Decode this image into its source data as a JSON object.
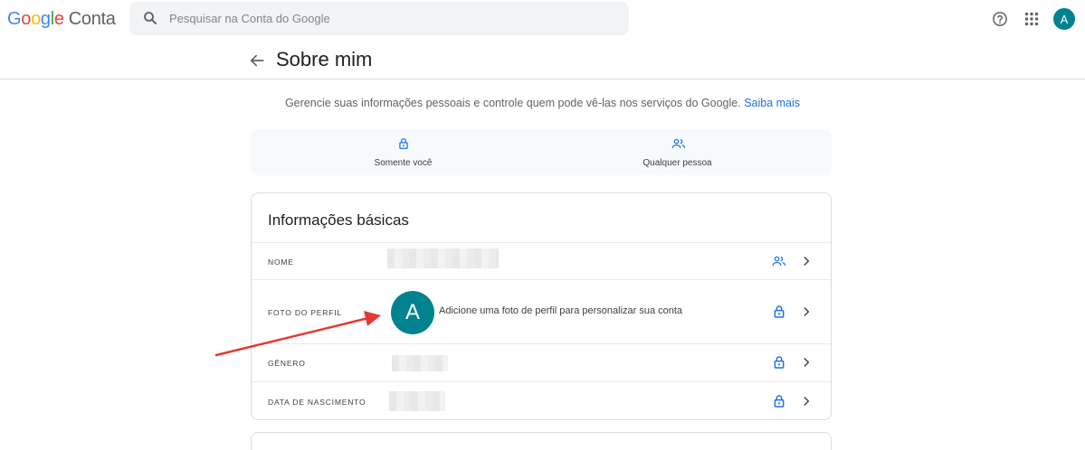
{
  "header": {
    "logo_letters": [
      "G",
      "o",
      "o",
      "g",
      "l",
      "e"
    ],
    "logo_suffix": "Conta",
    "search_placeholder": "Pesquisar na Conta do Google",
    "help_icon": "help-circle-icon",
    "apps_icon": "apps-grid-icon",
    "avatar_letter": "A"
  },
  "page": {
    "title": "Sobre mim",
    "intro_text": "Gerencie suas informações pessoais e controle quem pode vê-las nos serviços do Google.",
    "intro_link": "Saiba mais"
  },
  "visibility_legend": [
    {
      "label": "Somente você",
      "icon": "lock-icon"
    },
    {
      "label": "Qualquer pessoa",
      "icon": "people-icon"
    }
  ],
  "basic_info": {
    "title": "Informações básicas",
    "rows": [
      {
        "label": "NOME",
        "value": "",
        "icon": "people-icon"
      },
      {
        "label": "FOTO DO PERFIL",
        "value": "Adicione uma foto de perfil para personalizar sua conta",
        "avatar_letter": "A",
        "icon": "lock-icon"
      },
      {
        "label": "GÊNERO",
        "value": "",
        "icon": "lock-icon"
      },
      {
        "label": "DATA DE NASCIMENTO",
        "value": "",
        "icon": "lock-icon"
      }
    ]
  },
  "colors": {
    "accent": "#1a73e8",
    "avatar": "#00838f",
    "annotation_arrow": "#e53935"
  }
}
